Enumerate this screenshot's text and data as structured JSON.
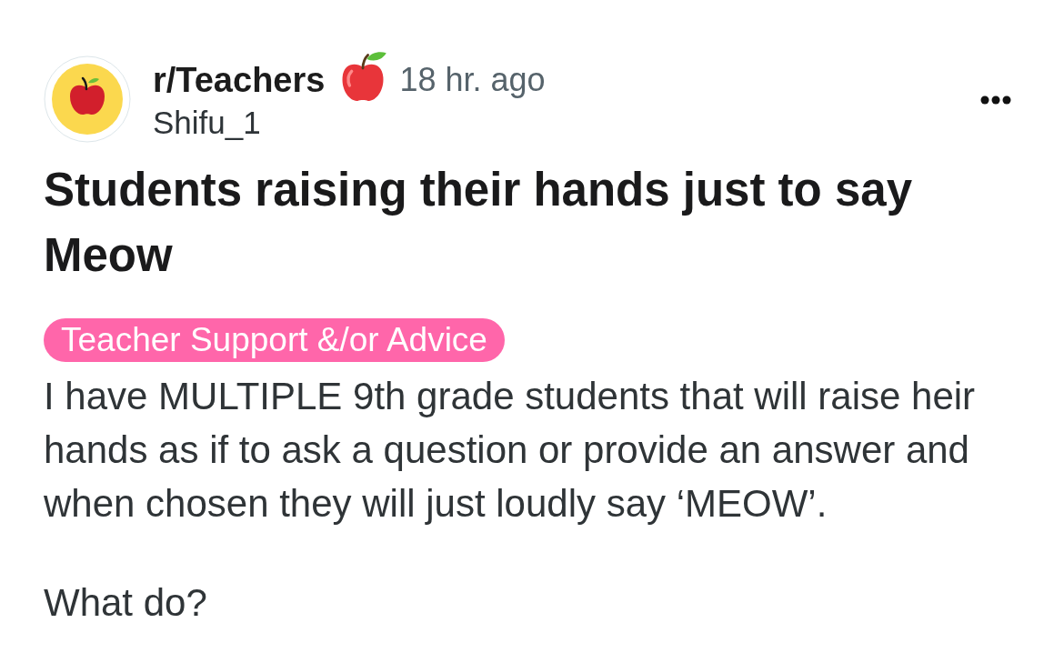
{
  "post": {
    "community": "r/Teachers",
    "time": "18 hr. ago",
    "author": "Shifu_1",
    "title": "Students raising their hands just to say Meow",
    "flair": "Teacher Support &/or Advice",
    "body": [
      "I have MULTIPLE 9th grade students that will raise heir hands as if to ask a question or provide an answer and when chosen they will just loudly say ‘MEOW’.",
      "What do?"
    ]
  }
}
